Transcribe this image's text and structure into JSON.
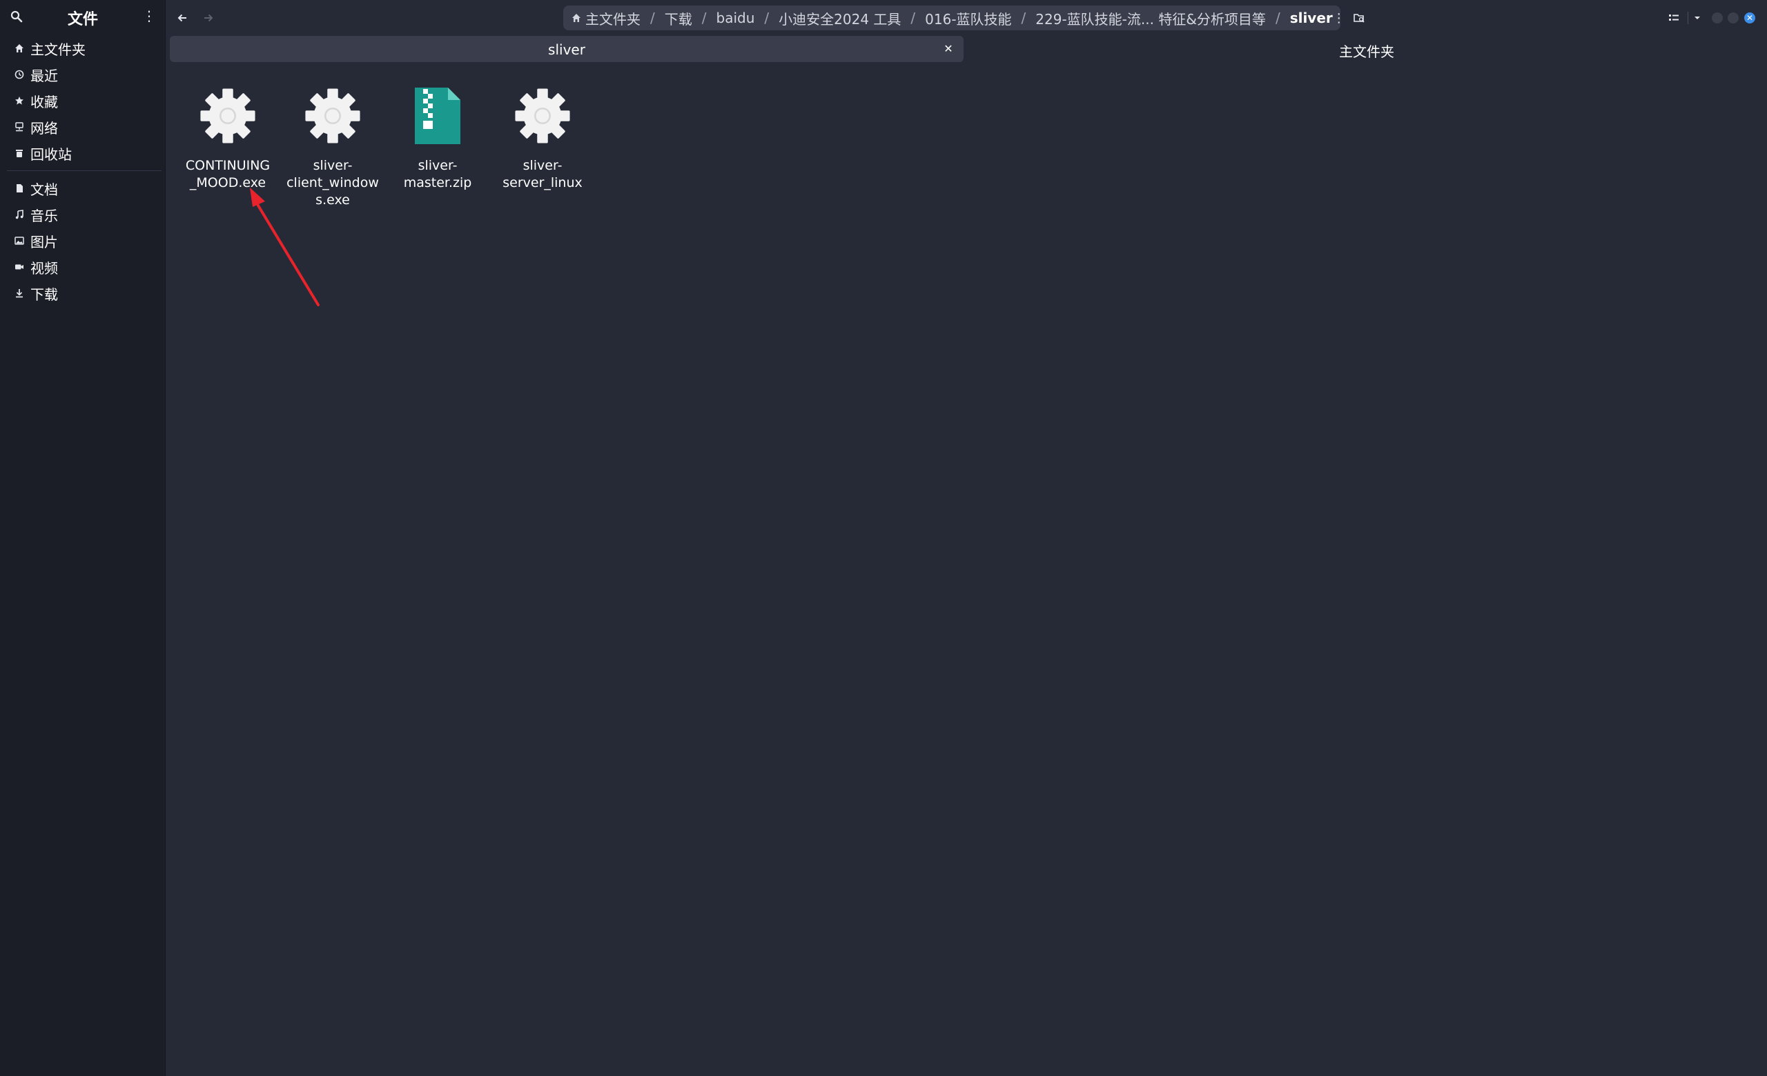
{
  "sidebar": {
    "title": "文件",
    "places": [
      {
        "label": "主文件夹",
        "icon": "home-icon"
      },
      {
        "label": "最近",
        "icon": "clock-icon"
      },
      {
        "label": "收藏",
        "icon": "star-icon"
      },
      {
        "label": "网络",
        "icon": "network-icon"
      },
      {
        "label": "回收站",
        "icon": "trash-icon"
      }
    ],
    "bookmarks": [
      {
        "label": "文档",
        "icon": "document-icon"
      },
      {
        "label": "音乐",
        "icon": "music-icon"
      },
      {
        "label": "图片",
        "icon": "picture-icon"
      },
      {
        "label": "视频",
        "icon": "video-icon"
      },
      {
        "label": "下载",
        "icon": "download-icon"
      }
    ]
  },
  "breadcrumb": {
    "items": [
      "主文件夹",
      "下载",
      "baidu",
      "小迪安全2024 工具",
      "016-蓝队技能",
      "229-蓝队技能-流... 特征&分析项目等",
      "sliver"
    ],
    "separator": "/"
  },
  "search": {
    "query": "sliver",
    "scope": "主文件夹"
  },
  "files": [
    {
      "name": "CONTINUING\n_MOOD.exe",
      "type": "executable",
      "icon": "gear-icon"
    },
    {
      "name": "sliver-\nclient_window\ns.exe",
      "type": "executable",
      "icon": "gear-icon"
    },
    {
      "name": "sliver-\nmaster.zip",
      "type": "archive",
      "icon": "zip-archive-icon"
    },
    {
      "name": "sliver-\nserver_linux",
      "type": "executable",
      "icon": "gear-icon"
    }
  ],
  "colors": {
    "sidebar_bg": "#1b1e27",
    "main_bg": "#262a37",
    "pill_bg": "#3a3e4c",
    "zip_teal": "#1a9a8f",
    "close_blue": "#3d8ee8",
    "annotation_red": "#e8232b"
  }
}
